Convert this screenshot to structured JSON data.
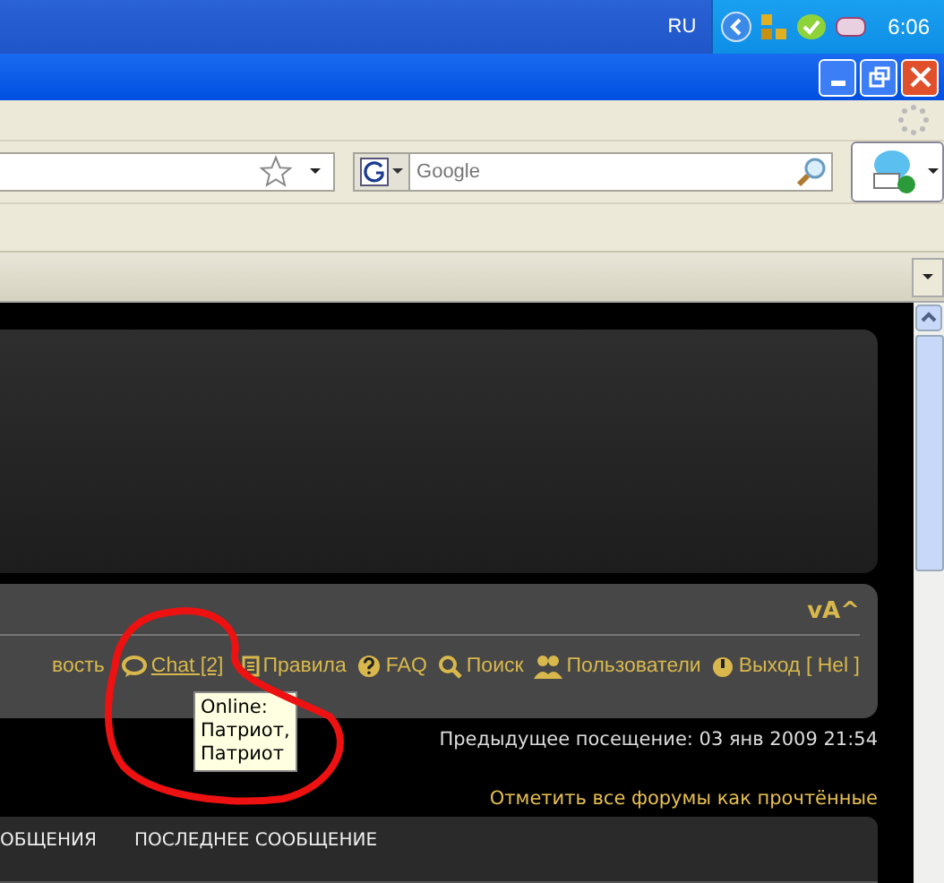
{
  "taskbar": {
    "language": "RU",
    "clock": "6:06"
  },
  "search": {
    "placeholder": "Google"
  },
  "forum": {
    "font_controls": "vA^",
    "nav_links": [
      {
        "label": "вость",
        "kind": "none",
        "hovered": false
      },
      {
        "label": "Chat [2]",
        "kind": "chat",
        "hovered": true
      },
      {
        "label": "Правила",
        "kind": "rules",
        "hovered": false
      },
      {
        "label": "FAQ",
        "kind": "faq",
        "hovered": false
      },
      {
        "label": "Поиск",
        "kind": "search",
        "hovered": false
      },
      {
        "label": "Пользователи",
        "kind": "users",
        "hovered": false
      },
      {
        "label": "Выход [ Hel ]",
        "kind": "logout",
        "hovered": false
      }
    ],
    "tooltip": {
      "lines": [
        "Online:",
        "Патриот,",
        "Патриот"
      ]
    },
    "previous_visit": "Предыдущее посещение: 03 янв 2009 21:54",
    "mark_read_link": "Отметить все форумы как прочтённые",
    "table": {
      "columns": [
        "ОБЩЕНИЯ",
        "ПОСЛЕДНЕЕ СООБЩЕНИЕ"
      ]
    }
  }
}
